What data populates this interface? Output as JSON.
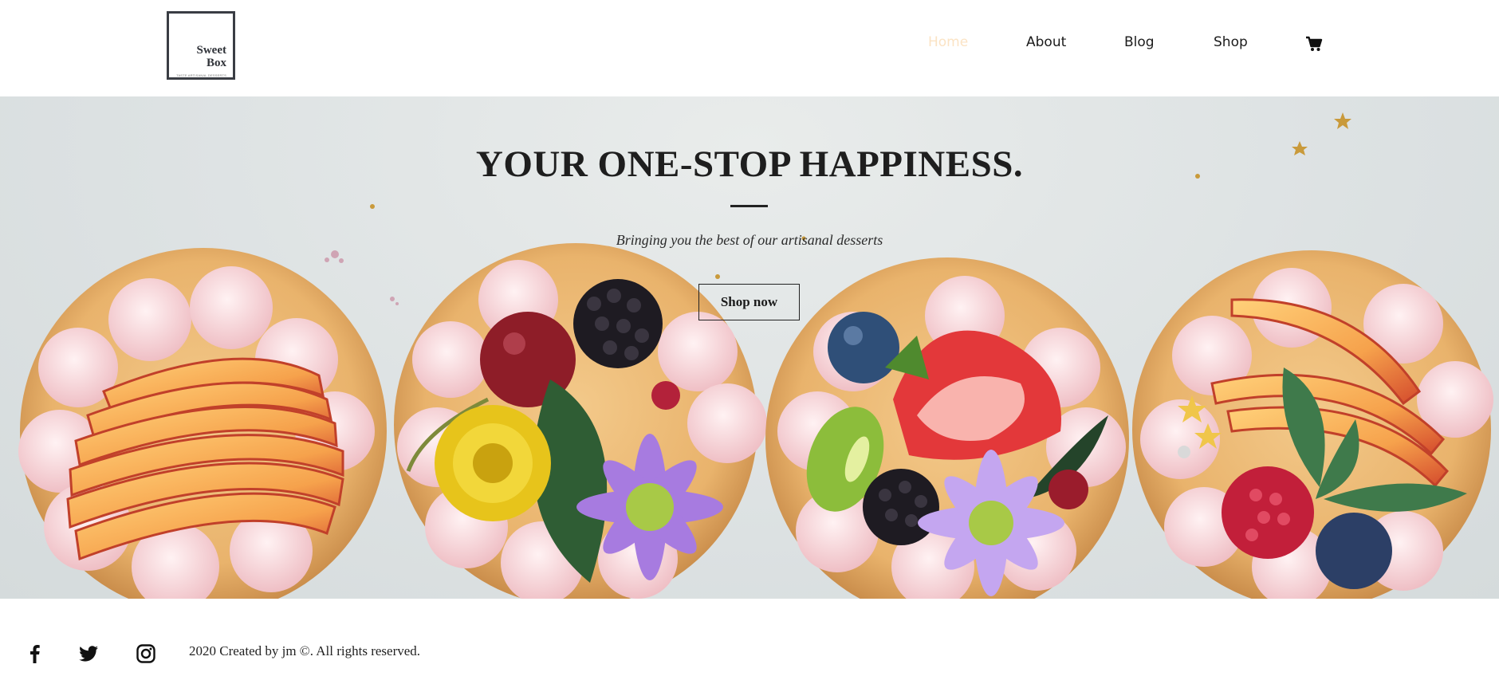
{
  "brand": {
    "logo_line1": "Sweet",
    "logo_line2": "Box",
    "logo_tagline": "TASTE ARTISANAL DESSERTS"
  },
  "nav": {
    "items": [
      {
        "label": "Home",
        "active": true
      },
      {
        "label": "About",
        "active": false
      },
      {
        "label": "Blog",
        "active": false
      },
      {
        "label": "Shop",
        "active": false
      }
    ],
    "cart_icon": "shopping-cart-icon"
  },
  "hero": {
    "title": "YOUR ONE-STOP HAPPINESS.",
    "subtitle": "Bringing you the best of our artisanal desserts",
    "cta_label": "Shop now",
    "image": "fruit-topped-tartlets-photo"
  },
  "footer": {
    "social_icons": [
      "facebook-icon",
      "twitter-icon",
      "instagram-icon"
    ],
    "copyright": "2020 Created by jm ©. All rights reserved."
  },
  "colors": {
    "nav_active": "#fbe3c4",
    "text": "#1b1b1b"
  }
}
